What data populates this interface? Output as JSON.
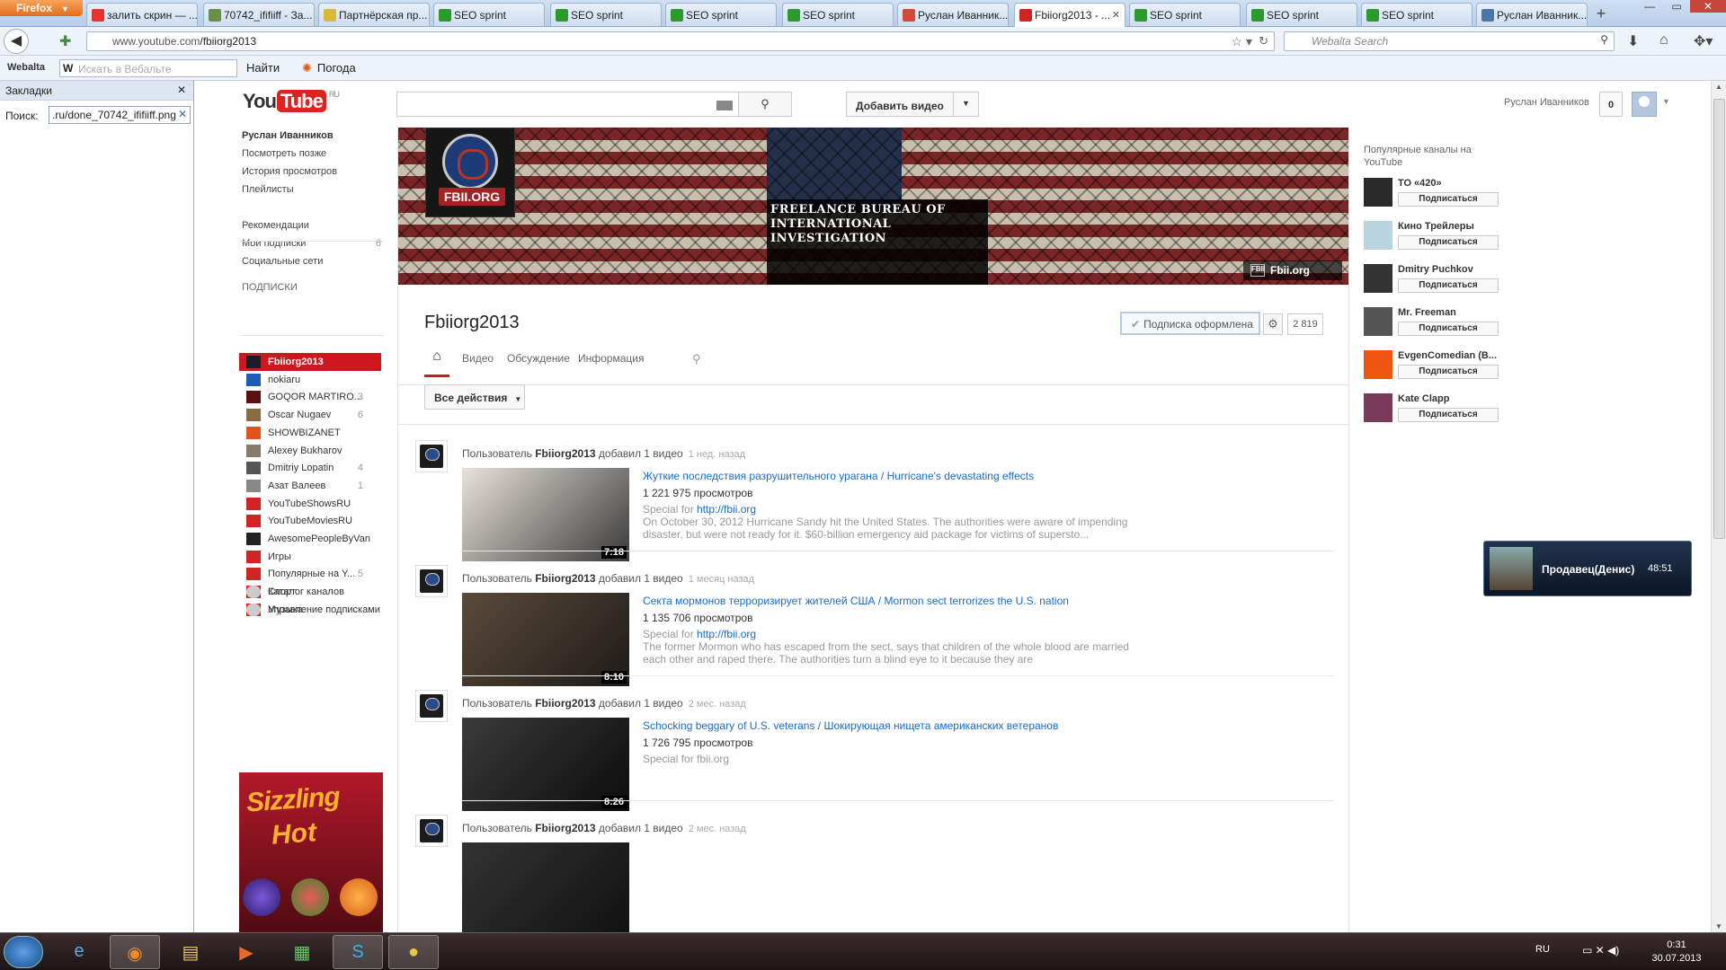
{
  "browser": {
    "firefox_label": "Firefox",
    "tabs": [
      {
        "label": "залить скрин — ...",
        "color": "#e8322e",
        "active": false
      },
      {
        "label": "70742_ififiiff - За...",
        "color": "#6a8f4a",
        "active": false
      },
      {
        "label": "Партнёрская пр...",
        "color": "#d8b93a",
        "active": false
      },
      {
        "label": "SEO sprint",
        "color": "#2b9b2b",
        "active": false
      },
      {
        "label": "SEO sprint",
        "color": "#2b9b2b",
        "active": false
      },
      {
        "label": "SEO sprint",
        "color": "#2b9b2b",
        "active": false
      },
      {
        "label": "SEO sprint",
        "color": "#2b9b2b",
        "active": false
      },
      {
        "label": "Руслан Иванник...",
        "color": "#d34836",
        "active": false
      },
      {
        "label": "Fbiiorg2013 - ...",
        "color": "#d22222",
        "active": true
      },
      {
        "label": "SEO sprint",
        "color": "#2b9b2b",
        "active": false
      },
      {
        "label": "SEO sprint",
        "color": "#2b9b2b",
        "active": false
      },
      {
        "label": "SEO sprint",
        "color": "#2b9b2b",
        "active": false
      },
      {
        "label": "Руслан Иванник...",
        "color": "#4a76a8",
        "active": false
      }
    ],
    "url_prefix": "www.youtube.com",
    "url_path": "/fbiiorg2013",
    "search_placeholder": "Webalta Search",
    "webalta_label": "Webalta",
    "webalta_search_placeholder": "Искать в Вебальте",
    "find_label": "Найти",
    "weather_label": "Погода"
  },
  "bookmarks": {
    "title": "Закладки",
    "search_label": "Поиск:",
    "search_value": ".ru/done_70742_ififiiff.png"
  },
  "youtube": {
    "logo_you": "You",
    "logo_tube": "Tube",
    "logo_region": "RU",
    "search_placeholder": "",
    "add_video_label": "Добавить видео",
    "user_name": "Руслан Иванников",
    "notifications": "0",
    "guide": {
      "user": "Руслан Иванников",
      "items_top": [
        "Посмотреть позже",
        "История просмотров",
        "Плейлисты"
      ],
      "items_mid": [
        {
          "label": "Рекомендации",
          "count": ""
        },
        {
          "label": "Мои подписки",
          "count": "6"
        },
        {
          "label": "Социальные сети",
          "count": ""
        }
      ],
      "subs_header": "ПОДПИСКИ",
      "subscriptions": [
        {
          "label": "Fbiiorg2013",
          "count": "",
          "icon": "#1c1c2c",
          "selected": true
        },
        {
          "label": "nokiaru",
          "count": "",
          "icon": "#1d5bb5",
          "selected": false
        },
        {
          "label": "GOQOR MARTIRO...",
          "count": "3",
          "icon": "#5a1010",
          "selected": false
        },
        {
          "label": "Oscar Nugaev",
          "count": "6",
          "icon": "#8a6a40",
          "selected": false
        },
        {
          "label": "SHOWBIZANET",
          "count": "",
          "icon": "#e2531f",
          "selected": false
        },
        {
          "label": "Alexey Bukharov",
          "count": "",
          "icon": "#8a7a6a",
          "selected": false
        },
        {
          "label": "Dmitriy Lopatin",
          "count": "4",
          "icon": "#555555",
          "selected": false
        },
        {
          "label": "Азат Валеев",
          "count": "1",
          "icon": "#888888",
          "selected": false
        },
        {
          "label": "YouTubeShowsRU",
          "count": "",
          "icon": "#d22222",
          "selected": false
        },
        {
          "label": "YouTubeMoviesRU",
          "count": "",
          "icon": "#d22222",
          "selected": false
        },
        {
          "label": "AwesomePeopleByVan",
          "count": "",
          "icon": "#222222",
          "selected": false
        },
        {
          "label": "Игры",
          "count": "",
          "icon": "#d22222",
          "selected": false
        },
        {
          "label": "Популярные на Y...",
          "count": "5",
          "icon": "#d22222",
          "selected": false
        },
        {
          "label": "Спорт",
          "count": "",
          "icon": "#d22222",
          "selected": false
        },
        {
          "label": "Музыка",
          "count": "",
          "icon": "#d22222",
          "selected": false
        }
      ],
      "bottom": [
        "Каталог каналов",
        "Управление подписками"
      ]
    },
    "ad": {
      "line1": "Sizzling",
      "line2": "Hot"
    },
    "banner": {
      "logo_text": "FBII.ORG",
      "title_line1": "FREELANCE BUREAU OF",
      "title_line2": "INTERNATIONAL INVESTIGATION",
      "link": "Fbii.org"
    },
    "channel": {
      "name": "Fbiiorg2013",
      "subscribed_label": "Подписка оформлена",
      "subscriber_count": "2 819",
      "tabs": [
        "Видео",
        "Обсуждение",
        "Информация"
      ],
      "all_actions": "Все действия"
    },
    "feed": [
      {
        "user_prefix": "Пользователь",
        "user": "Fbiiorg2013",
        "action": "добавил 1 видео",
        "ago": "1 нед. назад",
        "title": "Жуткие последствия разрушительного урагана / Hurricane's devastating effects",
        "views": "1 221 975 просмотров",
        "desc_prefix": "Special for ",
        "desc_link": "http://fbii.org",
        "desc": "On October 30, 2012 Hurricane Sandy hit the United States. The authorities were aware of impending disaster, but were not ready for it. $60-billion emergency aid package for victims of supersto...",
        "duration": "7:18",
        "thumb": [
          "#e8e2dc",
          "#3a3a3a"
        ]
      },
      {
        "user_prefix": "Пользователь",
        "user": "Fbiiorg2013",
        "action": "добавил 1 видео",
        "ago": "1 месяц назад",
        "title": "Секта мормонов терроризирует жителей США / Mormon sect terrorizes the U.S. nation",
        "views": "1 135 706 просмотров",
        "desc_prefix": "Special for ",
        "desc_link": "http://fbii.org",
        "desc": "The former Mormon who has escaped from the sect, says that children of the whole blood are married each other and raped there. The authorities turn a blind eye to it because they are",
        "duration": "8:10",
        "thumb": [
          "#5a4a3a",
          "#1e1a18"
        ]
      },
      {
        "user_prefix": "Пользователь",
        "user": "Fbiiorg2013",
        "action": "добавил 1 видео",
        "ago": "2 мес. назад",
        "title": "Schocking beggary of U.S. veterans / Шокирующая нищета американских ветеранов",
        "views": "1 726 795 просмотров",
        "desc_prefix": "Special for fbii.org",
        "desc_link": "",
        "desc": "",
        "duration": "8:26",
        "thumb": [
          "#3a3a3a",
          "#0c0c0c"
        ]
      },
      {
        "user_prefix": "Пользователь",
        "user": "Fbiiorg2013",
        "action": "добавил 1 видео",
        "ago": "2 мес. назад",
        "title": "",
        "views": "",
        "desc_prefix": "",
        "desc_link": "",
        "desc": "",
        "duration": "",
        "thumb": [
          "#333333",
          "#111111"
        ]
      }
    ],
    "popular": {
      "header": "Популярные каналы на YouTube",
      "subscribe_label": "Подписаться",
      "channels": [
        {
          "name": "ТО «420»",
          "color": "#2a2a2a"
        },
        {
          "name": "Кино Трейлеры",
          "color": "#b8d4e0"
        },
        {
          "name": "Dmitry Puchkov",
          "color": "#333333"
        },
        {
          "name": "Mr. Freeman",
          "color": "#555555"
        },
        {
          "name": "EvgenComedian (B...",
          "color": "#ee5511"
        },
        {
          "name": "Kate Clapp",
          "color": "#7a3a5a"
        }
      ]
    },
    "popup": {
      "name": "Продавец(Денис)",
      "time": "48:51"
    }
  },
  "taskbar": {
    "lang": "RU",
    "time": "0:31",
    "date": "30.07.2013"
  }
}
